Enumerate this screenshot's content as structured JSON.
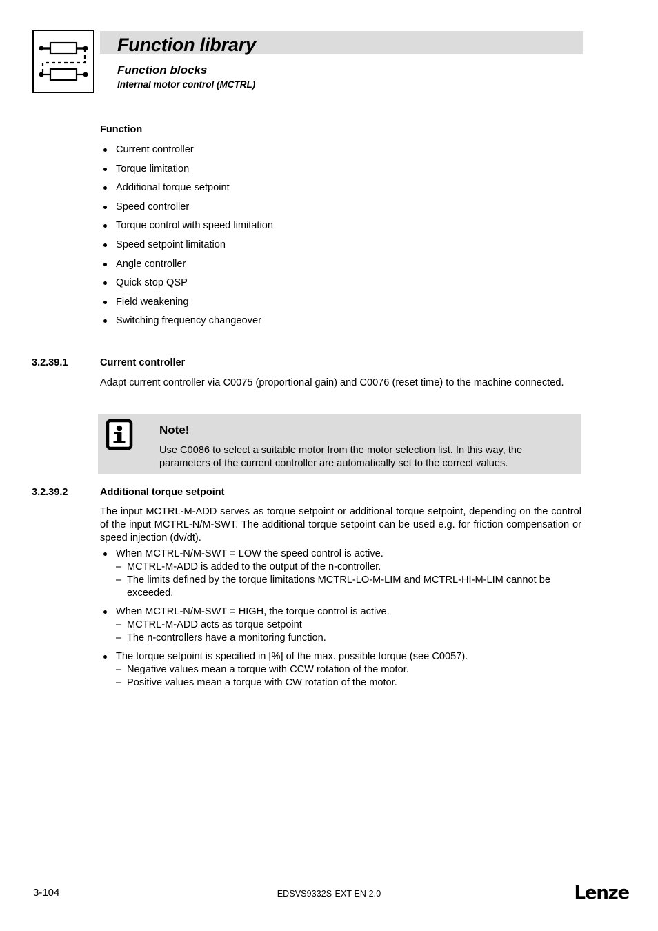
{
  "header": {
    "title": "Function library",
    "subtitle": "Function blocks",
    "subsubtitle": "Internal motor control (MCTRL)",
    "logo_icon": "two-function-blocks-diagram-icon",
    "band_color": "#dcdcdc"
  },
  "function_section": {
    "heading": "Function",
    "items": [
      "Current controller",
      "Torque limitation",
      "Additional torque setpoint",
      "Speed controller",
      "Torque control with speed limitation",
      "Speed setpoint limitation",
      "Angle controller",
      "Quick stop QSP",
      "Field weakening",
      "Switching frequency changeover"
    ]
  },
  "section_1": {
    "number": "3.2.39.1",
    "title": "Current controller",
    "paragraph": "Adapt current controller via C0075 (proportional gain) and C0076 (reset time) to the machine connected."
  },
  "note": {
    "icon": "info-icon",
    "title": "Note!",
    "text": "Use C0086 to select a suitable motor from the motor selection list. In this way, the parameters of the current controller are automatically set to the correct values.",
    "background_color": "#dcdcdc"
  },
  "section_2": {
    "number": "3.2.39.2",
    "title": "Additional torque setpoint",
    "paragraph": "The input MCTRL-M-ADD serves as torque setpoint or additional torque setpoint, depending on the control of the input MCTRL-N/M-SWT. The additional torque setpoint can be used e.g. for friction compensation or speed injection (dv/dt).",
    "bullets": [
      {
        "text": "When MCTRL-N/M-SWT = LOW the speed control is active.",
        "subitems": [
          "MCTRL-M-ADD is added to the output of the n-controller.",
          "The limits defined by the torque limitations MCTRL-LO-M-LIM and MCTRL-HI-M-LIM cannot be exceeded."
        ]
      },
      {
        "text": "When MCTRL-N/M-SWT = HIGH, the torque control is active.",
        "subitems": [
          "MCTRL-M-ADD acts as torque setpoint",
          "The n-controllers have a monitoring function."
        ]
      },
      {
        "text": "The torque setpoint is specified in [%] of the max. possible torque (see C0057).",
        "subitems": [
          "Negative values mean a torque with CCW rotation of the motor.",
          "Positive values mean a torque with CW rotation of the motor."
        ]
      }
    ]
  },
  "footer": {
    "page_number": "3-104",
    "document_id": "EDSVS9332S-EXT EN 2.0",
    "brand": "Lenze"
  }
}
